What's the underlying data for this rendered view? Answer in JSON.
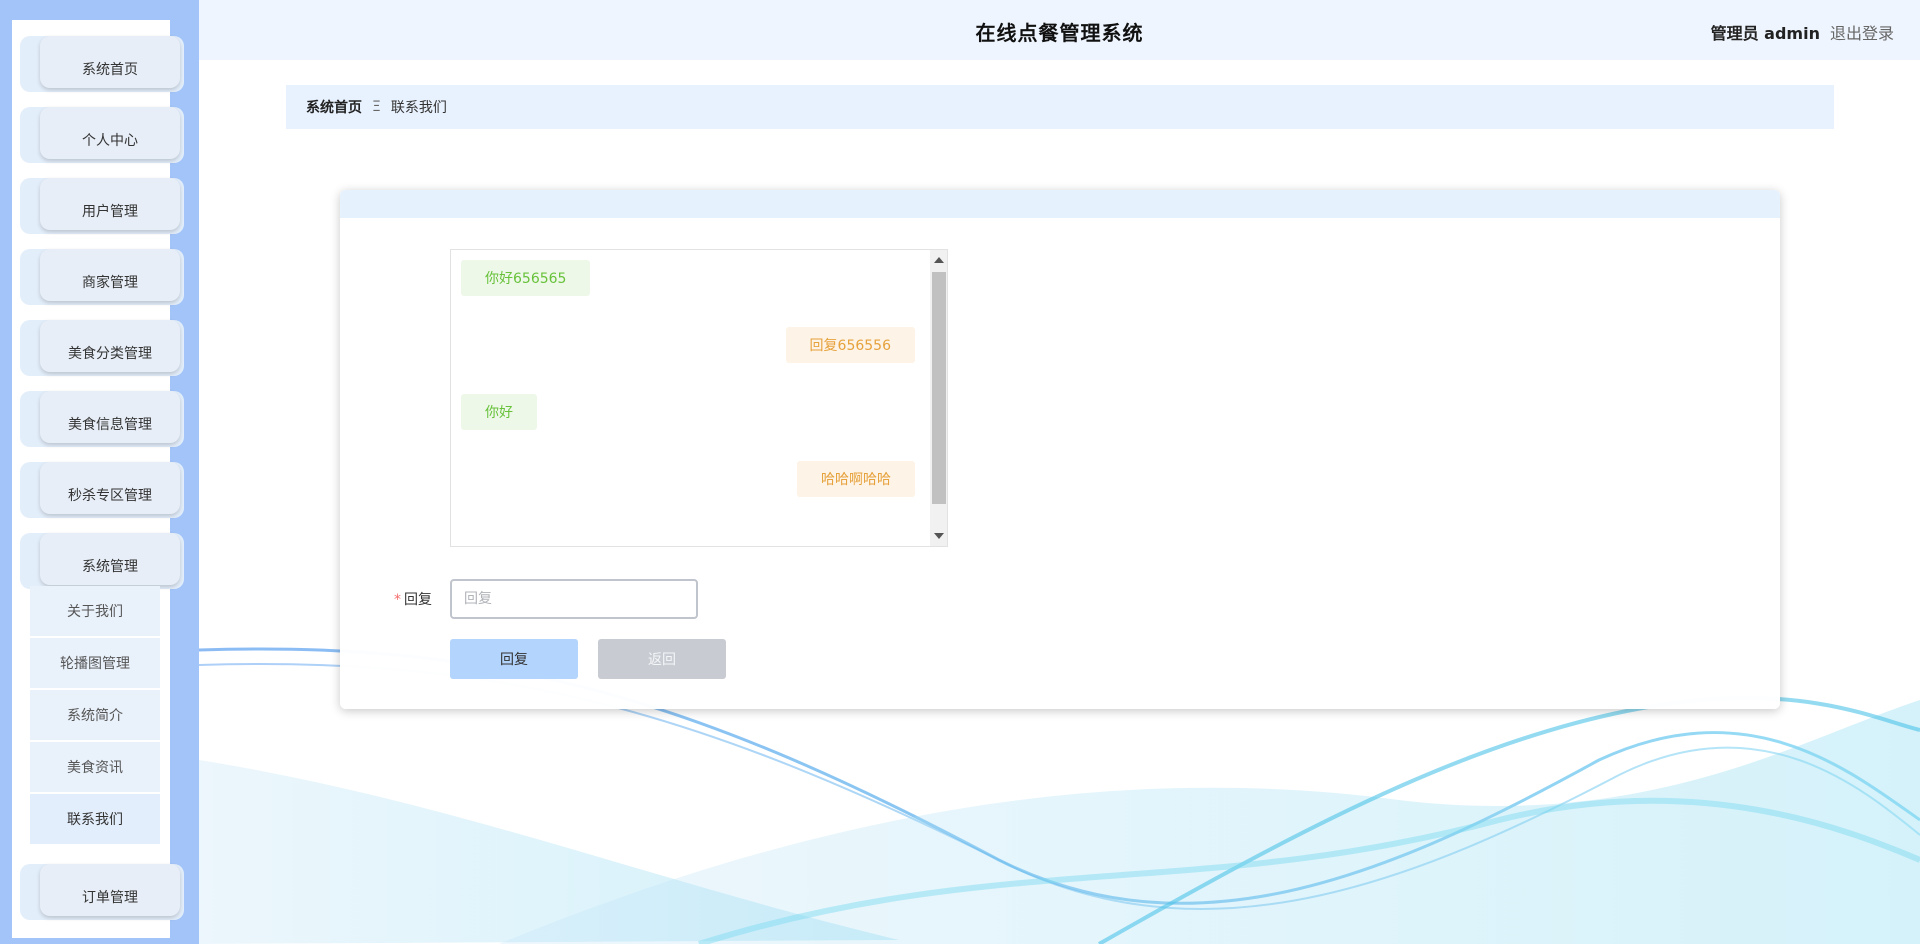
{
  "header": {
    "title": "在线点餐管理系统",
    "admin_label": "管理员 admin",
    "logout_label": "退出登录"
  },
  "sidebar": {
    "items": [
      {
        "label": "系统首页"
      },
      {
        "label": "个人中心"
      },
      {
        "label": "用户管理"
      },
      {
        "label": "商家管理"
      },
      {
        "label": "美食分类管理"
      },
      {
        "label": "美食信息管理"
      },
      {
        "label": "秒杀专区管理"
      },
      {
        "label": "系统管理"
      },
      {
        "label": "订单管理"
      }
    ],
    "submenu": [
      {
        "label": "关于我们"
      },
      {
        "label": "轮播图管理"
      },
      {
        "label": "系统简介"
      },
      {
        "label": "美食资讯"
      },
      {
        "label": "联系我们"
      }
    ]
  },
  "breadcrumb": {
    "home": "系统首页",
    "separator": "Ξ",
    "current": "联系我们"
  },
  "chat": {
    "messages": [
      {
        "side": "left",
        "text": "你好656565"
      },
      {
        "side": "right",
        "text": "回复656556"
      },
      {
        "side": "left",
        "text": "你好"
      },
      {
        "side": "right",
        "text": "哈哈啊哈哈"
      }
    ]
  },
  "form": {
    "required_mark": "*",
    "reply_label": "回复",
    "reply_placeholder": "回复",
    "reply_value": ""
  },
  "buttons": {
    "reply": "回复",
    "back": "返回"
  },
  "colors": {
    "sidebar_bg": "#a3c4f8",
    "header_bg": "#eef5fe",
    "accent": "#b3d4fc",
    "left_msg": "#67c23a",
    "right_msg": "#e6a23c"
  }
}
